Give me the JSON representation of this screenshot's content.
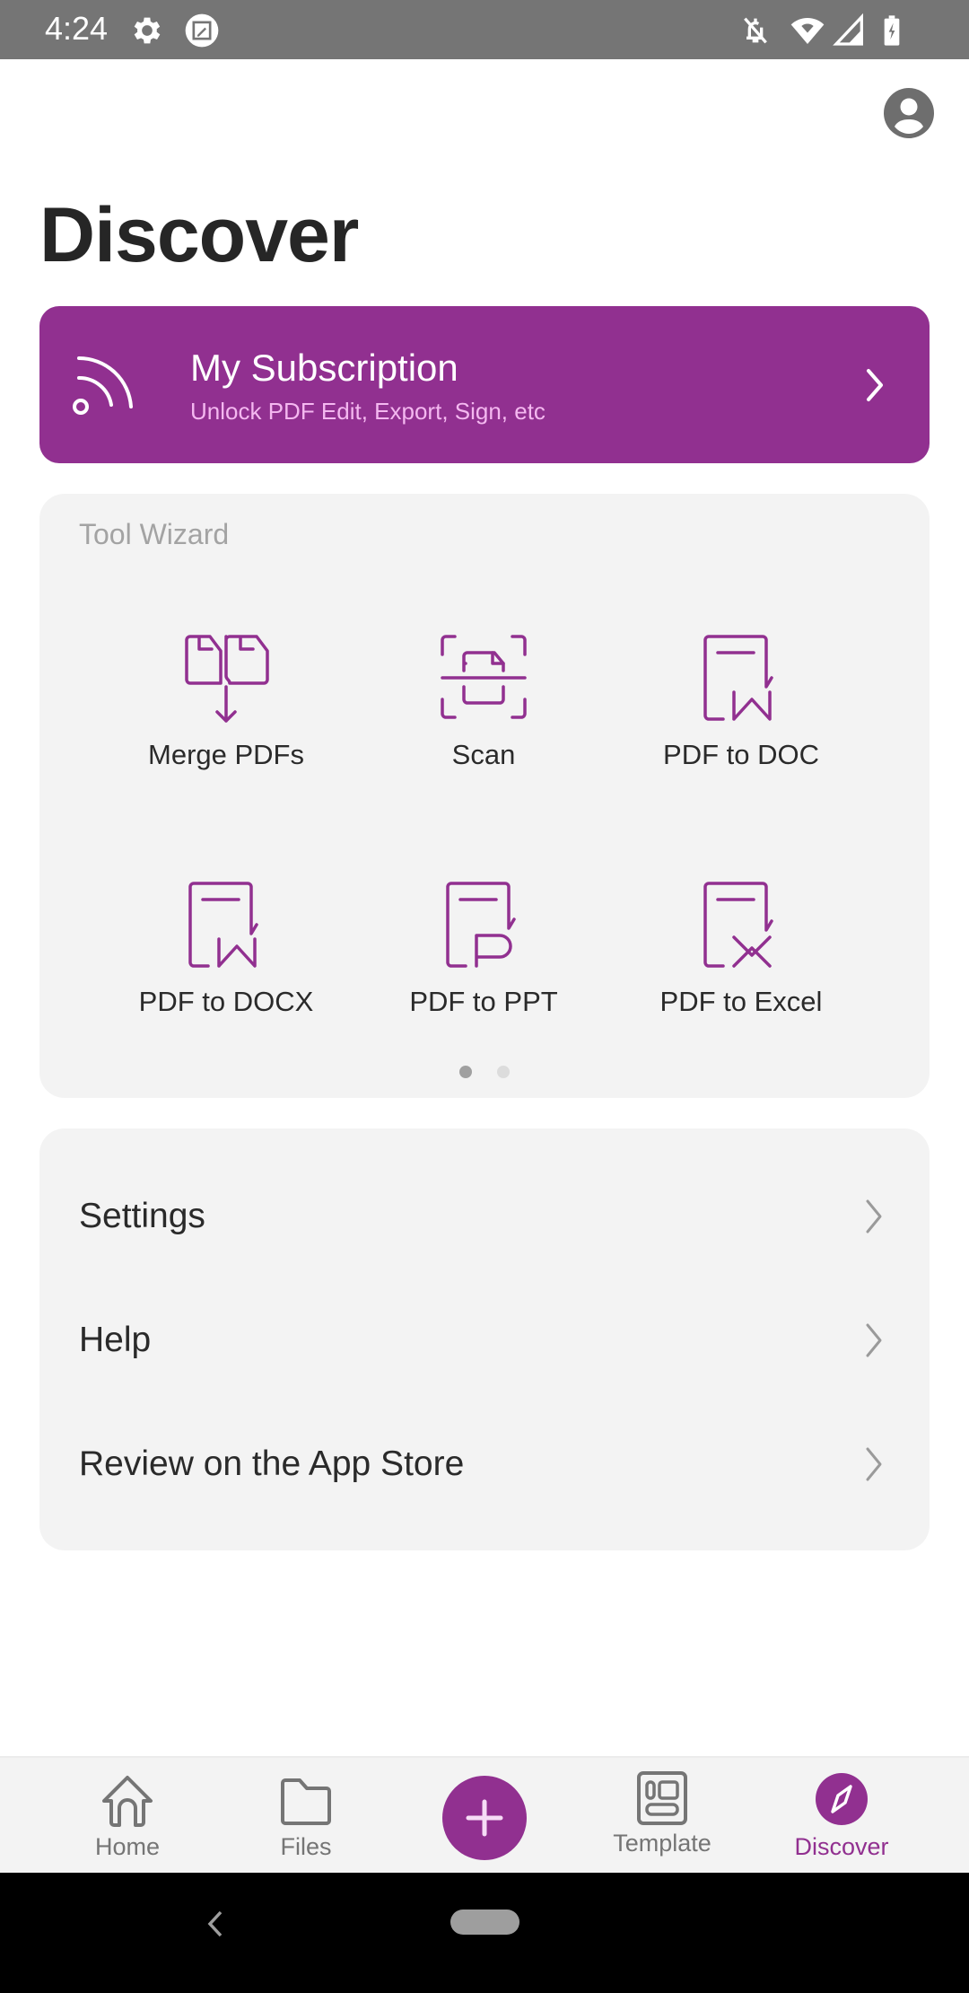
{
  "status_bar": {
    "time": "4:24",
    "left_icons": [
      "settings-gear-icon",
      "screenshot-edit-icon"
    ],
    "right_icons": [
      "notifications-off-icon",
      "wifi-icon",
      "cellular-signal-icon",
      "battery-charging-icon"
    ]
  },
  "header": {
    "title": "Discover",
    "profile_icon": "account-circle-icon"
  },
  "subscription": {
    "title": "My Subscription",
    "description": "Unlock PDF Edit, Export, Sign, etc",
    "icon": "feed-icon",
    "background": "#913090"
  },
  "tool_wizard": {
    "label": "Tool Wizard",
    "tools": [
      {
        "label": "Merge PDFs",
        "icon": "merge-pdfs-icon"
      },
      {
        "label": "Scan",
        "icon": "scan-icon"
      },
      {
        "label": "PDF to DOC",
        "icon": "pdf-to-doc-icon"
      },
      {
        "label": "PDF to DOCX",
        "icon": "pdf-to-docx-icon"
      },
      {
        "label": "PDF to PPT",
        "icon": "pdf-to-ppt-icon"
      },
      {
        "label": "PDF to Excel",
        "icon": "pdf-to-excel-icon"
      }
    ],
    "pages": 2,
    "current_page": 1
  },
  "menu": {
    "items": [
      {
        "label": "Settings"
      },
      {
        "label": "Help"
      },
      {
        "label": "Review on the App Store"
      }
    ]
  },
  "bottom_nav": {
    "items": [
      {
        "label": "Home",
        "icon": "home-icon",
        "active": false
      },
      {
        "label": "Files",
        "icon": "folder-icon",
        "active": false
      },
      {
        "label": "",
        "icon": "add-icon",
        "active": false
      },
      {
        "label": "Template",
        "icon": "template-icon",
        "active": false
      },
      {
        "label": "Discover",
        "icon": "compass-icon",
        "active": true
      }
    ]
  },
  "colors": {
    "accent": "#913090",
    "card_bg": "#f3f3f3",
    "text_primary": "#262626",
    "text_secondary": "#a3a3a3",
    "nav_inactive": "#757575"
  }
}
